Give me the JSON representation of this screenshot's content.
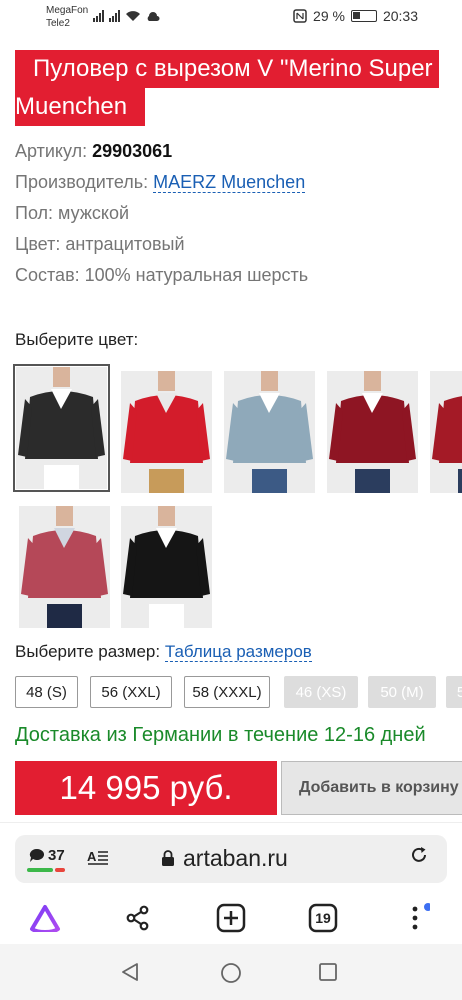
{
  "status_bar": {
    "carrier1": "MegaFon",
    "carrier2": "Tele2",
    "battery": "29 %",
    "time": "20:33"
  },
  "product": {
    "title_line1": "Пуловер с вырезом V \"Merino Super",
    "title_line2": "Muenchen",
    "article_label": "Артикул: ",
    "article_value": "29903061",
    "maker_label": "Производитель: ",
    "maker_value": "MAERZ Muenchen",
    "gender": "Пол: мужской",
    "color": "Цвет: антрацитовый",
    "composition": "Состав: 100% натуральная шерсть"
  },
  "color_picker": {
    "label": "Выберите цвет:",
    "swatches": [
      {
        "name": "anthracite",
        "color": "#2b2b2b",
        "selected": true
      },
      {
        "name": "red",
        "color": "#d31c2b"
      },
      {
        "name": "light-blue",
        "color": "#8fa9ba"
      },
      {
        "name": "burgundy",
        "color": "#8e1523"
      },
      {
        "name": "dark-red",
        "color": "#a41a26"
      },
      {
        "name": "raspberry",
        "color": "#b54858"
      },
      {
        "name": "black",
        "color": "#151515"
      }
    ]
  },
  "size_picker": {
    "label": "Выберите размер: ",
    "table_link": "Таблица размеров",
    "sizes": [
      {
        "label": "48 (S)",
        "available": true
      },
      {
        "label": "56 (XXL)",
        "available": true
      },
      {
        "label": "58 (XXXL)",
        "available": true
      },
      {
        "label": "46 (XS)",
        "available": false
      },
      {
        "label": "50 (M)",
        "available": false
      },
      {
        "label": "5",
        "available": false
      }
    ]
  },
  "delivery": "Доставка из Германии в течение 12-16 дней",
  "price": "14 995 руб.",
  "add_to_cart": "Добавить в корзину",
  "browser": {
    "chat_count": "37",
    "url": "artaban.ru",
    "tabs_count": "19"
  }
}
